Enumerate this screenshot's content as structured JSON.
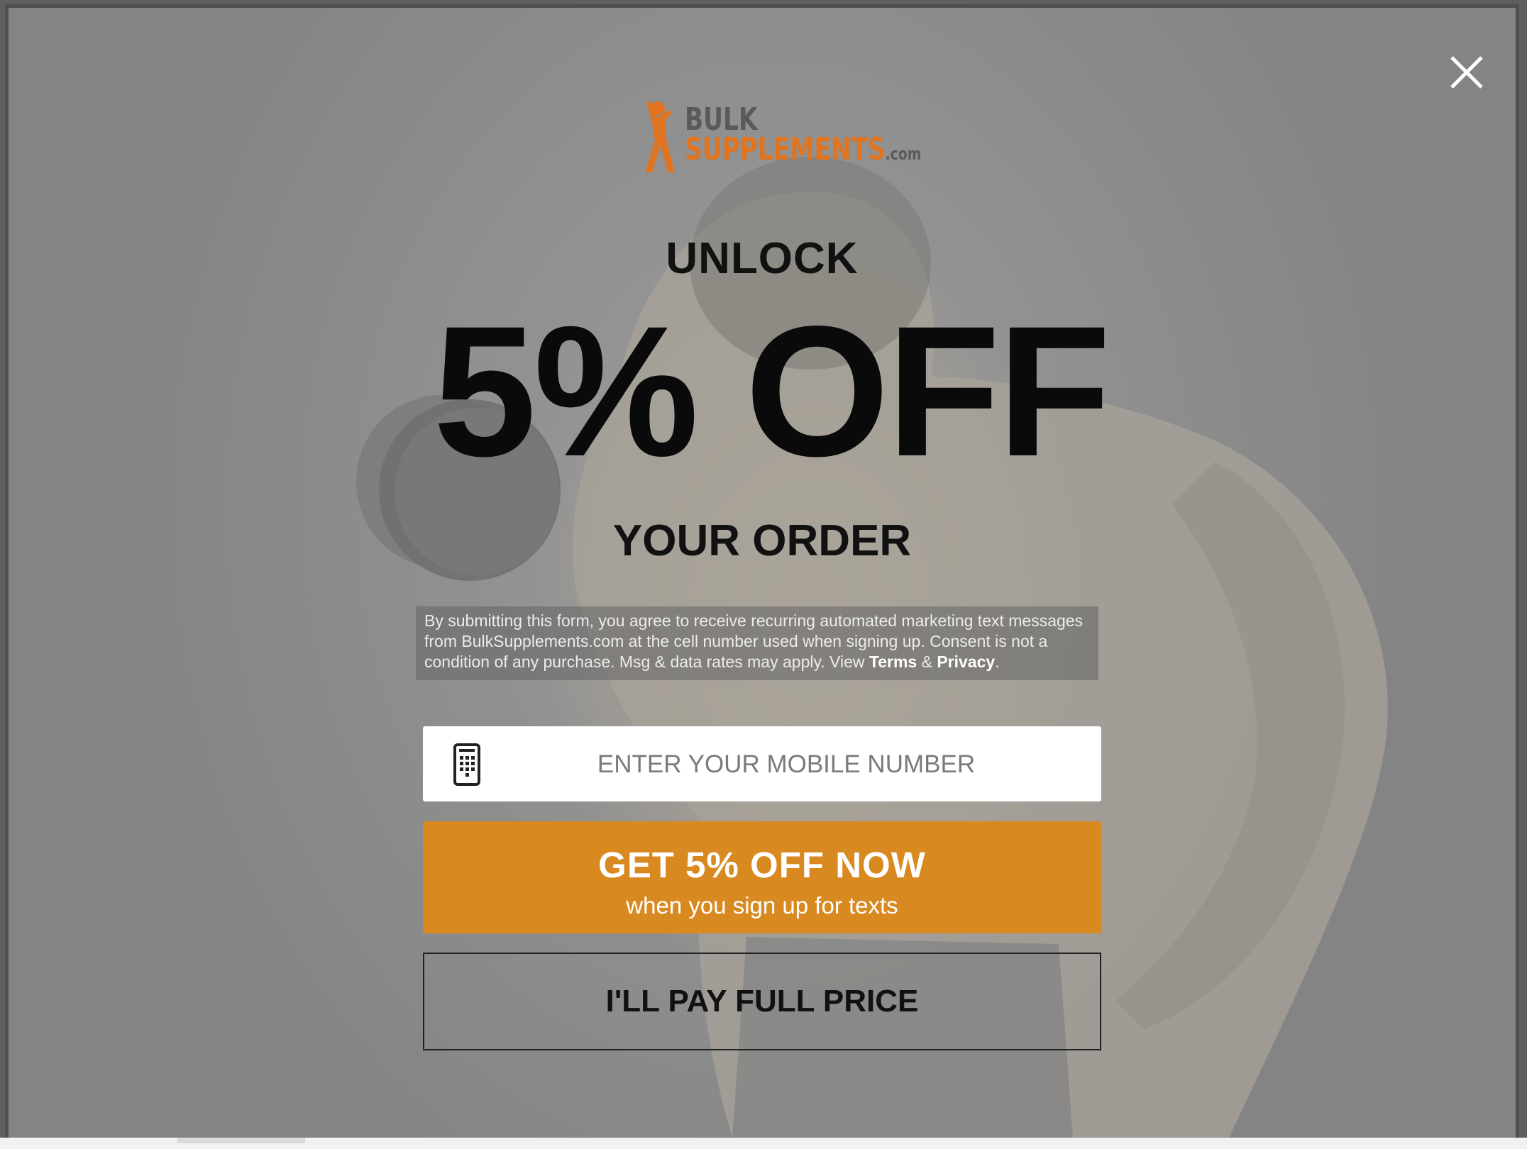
{
  "logo": {
    "line1": "BULK",
    "line2": "SUPPLEMENTS",
    "suffix": ".com",
    "brand_color": "#e07420"
  },
  "headline": {
    "top": "UNLOCK",
    "offer": "5% OFF",
    "bottom": "YOUR ORDER"
  },
  "disclaimer": {
    "text_before": "By submitting this form, you agree to receive recurring automated marketing text messages from BulkSupplements.com at the cell number used when signing up. Consent is not a condition of any purchase. Msg & data rates may apply. View ",
    "terms_link": "Terms",
    "joiner": " & ",
    "privacy_link": "Privacy",
    "end": "."
  },
  "form": {
    "phone_placeholder": "ENTER YOUR MOBILE NUMBER",
    "phone_icon": "mobile-phone-icon"
  },
  "cta": {
    "main": "GET 5% OFF NOW",
    "sub": "when you sign up for texts",
    "color": "#d88920"
  },
  "decline": {
    "label": "I'LL PAY FULL PRICE"
  },
  "close": {
    "icon": "close-icon"
  }
}
